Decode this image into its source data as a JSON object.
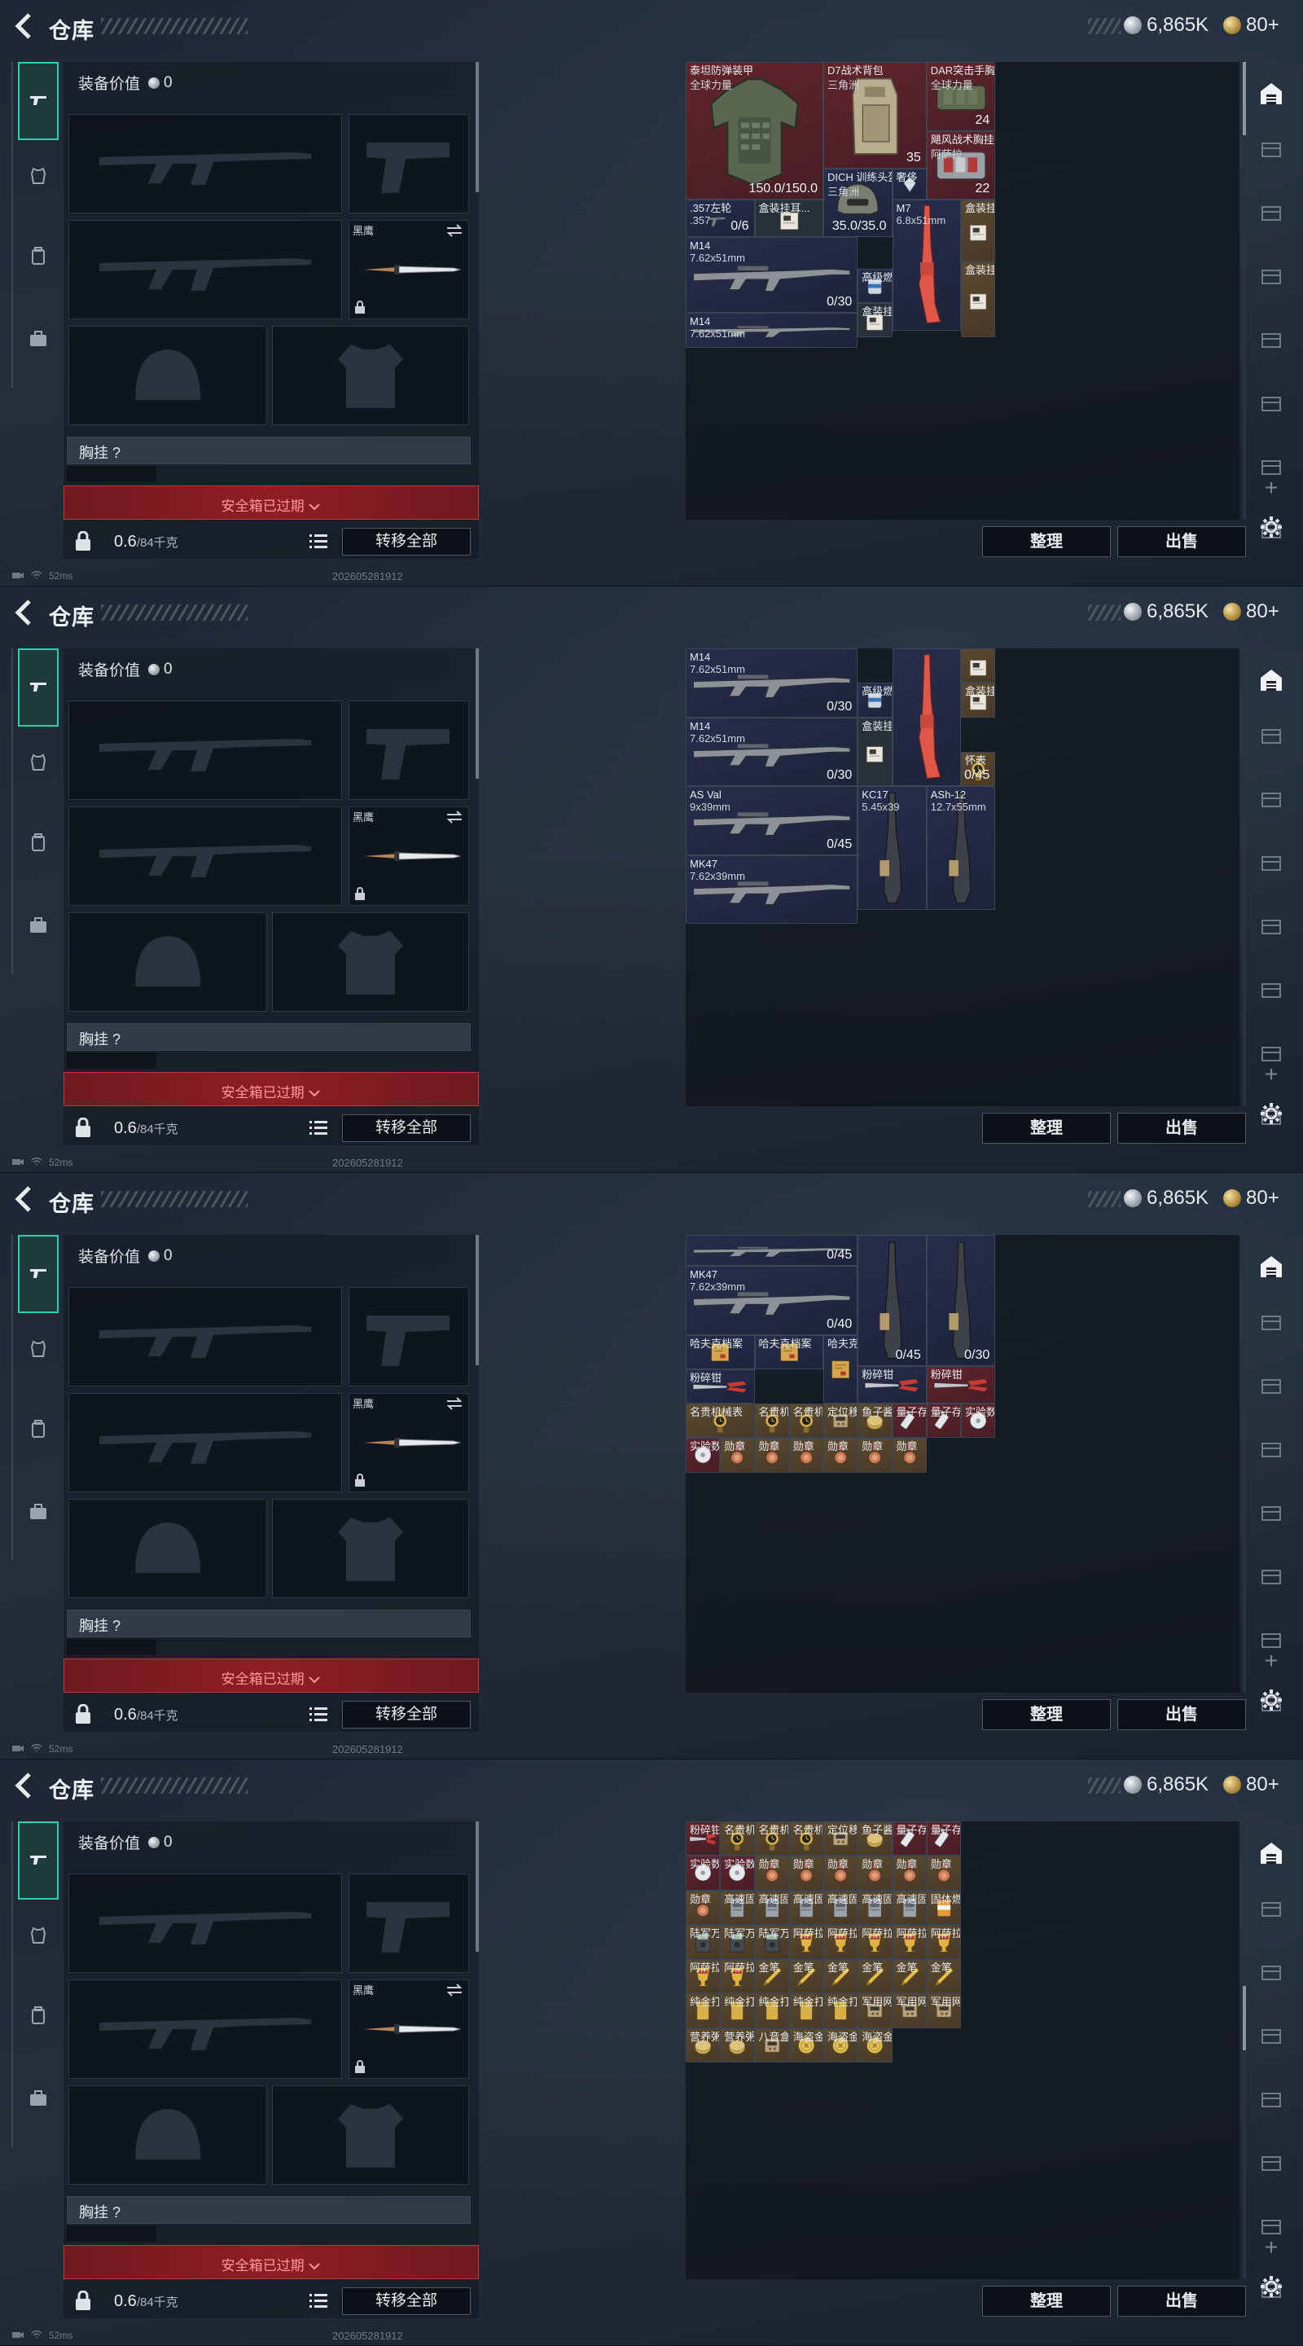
{
  "header": {
    "title": "仓库"
  },
  "currency": {
    "silver": "6,865K",
    "gold": "80+"
  },
  "equip": {
    "value_label": "装备价值",
    "value": "0",
    "knife_label": "黑鹰",
    "chest_label": "胸挂 ?",
    "expired_label": "安全箱已过期",
    "weight": "0.6",
    "weight_max": "/84千克",
    "transfer_all": "转移全部"
  },
  "stash": {
    "sort": "整理",
    "sell": "出售"
  },
  "status": {
    "ping": "52ms",
    "build": "202605281912"
  },
  "screens": [
    {
      "scroll": {
        "thumb_from": 0.0,
        "thumb_to": 0.16
      },
      "items": [
        {
          "c": "red",
          "name": "泰坦防弹装甲",
          "sub": "全球力量",
          "val": "150.0/150.0",
          "art": "armor"
        },
        {
          "c": "red",
          "name": "D7战术背包",
          "sub": "三角洲",
          "cnt": "35",
          "art": "backpack"
        },
        {
          "c": "red",
          "name": "DAR突击手胸挂",
          "sub": "全球力量",
          "cnt": "24",
          "art": "rig"
        },
        {
          "c": "red",
          "name": "飓风战术胸挂",
          "sub": "阿萨拉",
          "cnt": "22",
          "art": "rig2"
        },
        {
          "c": "blue",
          "name": "DICH 训练头盔",
          "sub": "三角洲",
          "val": "35.0/35.0",
          "art": "helmet"
        },
        {
          "c": "blue",
          "name": "奢侈",
          "sub": "",
          "art": "gem"
        },
        {
          "c": "blue",
          "name": ".357左轮",
          "sub": ".357",
          "cnt": "0/6",
          "art": "revolver"
        },
        {
          "c": "gray",
          "name": "盒装挂耳...",
          "sub": "",
          "art": "box"
        },
        {
          "c": "blue",
          "name": "M7",
          "sub": "6.8x51mm",
          "art": "rifle_red"
        },
        {
          "c": "gold",
          "name": "盒装挂耳...",
          "sub": "",
          "art": "box"
        },
        {
          "c": "blue",
          "name": "M14",
          "sub": "7.62x51mm",
          "cnt": "0/30",
          "art": "rifle"
        },
        {
          "c": "blue",
          "name": "高级燃料",
          "sub": "",
          "art": "can"
        },
        {
          "c": "gray",
          "name": "盒装挂耳...",
          "sub": "",
          "art": "box"
        },
        {
          "c": "blue",
          "name": "M14",
          "sub": "7.62x51mm",
          "art": "rifle"
        },
        {
          "c": "gold",
          "name": "盒装挂耳...",
          "sub": "",
          "art": "box"
        }
      ]
    },
    {
      "scroll": {
        "thumb_from": 0.0,
        "thumb_to": 0.0
      },
      "items": [
        {
          "c": "blue",
          "name": "M14",
          "sub": "7.62x51mm",
          "cnt": "0/30",
          "art": "rifle"
        },
        {
          "c": "blue",
          "name": "高级燃料",
          "sub": "",
          "art": "can"
        },
        {
          "c": "blue",
          "name": "",
          "sub": "",
          "art": "rifle_red"
        },
        {
          "c": "gold",
          "name": "",
          "sub": "",
          "art": "box"
        },
        {
          "c": "gold",
          "name": "盒装挂耳...",
          "sub": "",
          "art": "box"
        },
        {
          "c": "gray",
          "name": "盒装挂耳...",
          "sub": "",
          "art": "box"
        },
        {
          "c": "blue",
          "name": "M14",
          "sub": "7.62x51mm",
          "cnt": "0/30",
          "art": "rifle"
        },
        {
          "c": "gold",
          "name": "怀表",
          "sub": "",
          "cnt": "0/45",
          "art": "watch"
        },
        {
          "c": "blue",
          "name": "AS Val",
          "sub": "9x39mm",
          "cnt": "0/45",
          "art": "rifle"
        },
        {
          "c": "blue",
          "name": "KC17",
          "sub": "5.45x39",
          "art": "rifle_v"
        },
        {
          "c": "blue",
          "name": "ASh-12",
          "sub": "12.7x55mm",
          "art": "rifle_v"
        },
        {
          "c": "blue",
          "name": "MK47",
          "sub": "7.62x39mm",
          "art": "rifle"
        }
      ]
    },
    {
      "scroll": {
        "thumb_from": 0.0,
        "thumb_to": 0.0
      },
      "items": [
        {
          "c": "blue",
          "name": "",
          "sub": "",
          "cnt": "0/45",
          "art": "rifle"
        },
        {
          "c": "blue",
          "name": "MK47",
          "sub": "7.62x39mm",
          "cnt": "0/40",
          "art": "rifle"
        },
        {
          "c": "blue",
          "name": "",
          "sub": "",
          "cnt": "0/45",
          "art": "rifle_v"
        },
        {
          "c": "blue",
          "name": "",
          "sub": "",
          "cnt": "0/30",
          "art": "rifle_v"
        },
        {
          "c": "blue",
          "name": "哈夫克档案",
          "sub": "",
          "art": "doc"
        },
        {
          "c": "blue",
          "name": "哈夫克档案",
          "sub": "",
          "art": "doc"
        },
        {
          "c": "blue",
          "name": "哈夫克档案",
          "sub": "",
          "art": "doc"
        },
        {
          "c": "blue",
          "name": "粉碎钳",
          "sub": "",
          "art": "cutter"
        },
        {
          "c": "blue",
          "name": "粉碎钳",
          "sub": "",
          "art": "cutter"
        },
        {
          "c": "red",
          "name": "粉碎钳",
          "sub": "",
          "art": "cutter"
        },
        {
          "c": "gold",
          "name": "名贵机械表",
          "sub": "",
          "art": "watch"
        },
        {
          "c": "gold",
          "name": "名贵机械表",
          "sub": "",
          "art": "watch"
        },
        {
          "c": "gold",
          "name": "名贵机械表",
          "sub": "",
          "art": "watch"
        },
        {
          "c": "gold",
          "name": "定位移动器",
          "sub": "",
          "art": "device"
        },
        {
          "c": "gold",
          "name": "鱼子酱",
          "sub": "",
          "art": "tin"
        },
        {
          "c": "red",
          "name": "量子存储",
          "sub": "",
          "art": "usb"
        },
        {
          "c": "red",
          "name": "量子存储",
          "sub": "",
          "art": "usb"
        },
        {
          "c": "red",
          "name": "实验数据",
          "sub": "",
          "art": "disc"
        },
        {
          "c": "red",
          "name": "实验数据",
          "sub": "",
          "art": "disc"
        },
        {
          "c": "gold",
          "name": "勋章",
          "sub": "",
          "art": "medal"
        },
        {
          "c": "gold",
          "name": "勋章",
          "sub": "",
          "art": "medal"
        },
        {
          "c": "gold",
          "name": "勋章",
          "sub": "",
          "art": "medal"
        },
        {
          "c": "gold",
          "name": "勋章",
          "sub": "",
          "art": "medal"
        },
        {
          "c": "gold",
          "name": "勋章",
          "sub": "",
          "art": "medal"
        },
        {
          "c": "gold",
          "name": "勋章",
          "sub": "",
          "art": "medal"
        }
      ]
    },
    {
      "scroll": {
        "thumb_from": 0.36,
        "thumb_to": 0.5
      },
      "items": [
        {
          "c": "red",
          "name": "粉碎钳",
          "sub": "",
          "art": "cutter"
        },
        {
          "c": "gold",
          "name": "名贵机械表",
          "sub": "",
          "art": "watch"
        },
        {
          "c": "gold",
          "name": "名贵机械表",
          "sub": "",
          "art": "watch"
        },
        {
          "c": "gold",
          "name": "名贵机械表",
          "sub": "",
          "art": "watch"
        },
        {
          "c": "gold",
          "name": "定位移动器",
          "sub": "",
          "art": "device"
        },
        {
          "c": "gold",
          "name": "鱼子酱",
          "sub": "",
          "art": "tin"
        },
        {
          "c": "red",
          "name": "量子存储",
          "sub": "",
          "art": "usb"
        },
        {
          "c": "red",
          "name": "量子存储",
          "sub": "",
          "art": "usb"
        },
        {
          "c": "red",
          "name": "实验数据",
          "sub": "",
          "art": "disc"
        },
        {
          "c": "red",
          "name": "实验数据",
          "sub": "",
          "art": "disc"
        },
        {
          "c": "gold",
          "name": "勋章",
          "sub": "",
          "art": "medal"
        },
        {
          "c": "gold",
          "name": "勋章",
          "sub": "",
          "art": "medal"
        },
        {
          "c": "gold",
          "name": "勋章",
          "sub": "",
          "art": "medal"
        },
        {
          "c": "gold",
          "name": "勋章",
          "sub": "",
          "art": "medal"
        },
        {
          "c": "gold",
          "name": "勋章",
          "sub": "",
          "art": "medal"
        },
        {
          "c": "gold",
          "name": "勋章",
          "sub": "",
          "art": "medal"
        },
        {
          "c": "gold",
          "name": "勋章",
          "sub": "",
          "art": "medal"
        },
        {
          "c": "gold",
          "name": "高速固态...",
          "sub": "",
          "art": "ssd"
        },
        {
          "c": "gold",
          "name": "高速固态...",
          "sub": "",
          "art": "ssd"
        },
        {
          "c": "gold",
          "name": "高速固态...",
          "sub": "",
          "art": "ssd"
        },
        {
          "c": "gold",
          "name": "高速固态...",
          "sub": "",
          "art": "ssd"
        },
        {
          "c": "gold",
          "name": "高速固态...",
          "sub": "",
          "art": "ssd"
        },
        {
          "c": "gold",
          "name": "高速固态...",
          "sub": "",
          "art": "ssd"
        },
        {
          "c": "gold",
          "name": "固体燃料",
          "sub": "",
          "art": "fuel"
        },
        {
          "c": "gold",
          "name": "陆军万用表",
          "sub": "",
          "art": "meter"
        },
        {
          "c": "gold",
          "name": "陆军万用表",
          "sub": "",
          "art": "meter"
        },
        {
          "c": "gold",
          "name": "陆军万用表",
          "sub": "",
          "art": "meter"
        },
        {
          "c": "gold",
          "name": "阿萨拉酒杯",
          "sub": "",
          "art": "cup"
        },
        {
          "c": "gold",
          "name": "阿萨拉酒杯",
          "sub": "",
          "art": "cup"
        },
        {
          "c": "gold",
          "name": "阿萨拉酒杯",
          "sub": "",
          "art": "cup"
        },
        {
          "c": "gold",
          "name": "阿萨拉酒杯",
          "sub": "",
          "art": "cup"
        },
        {
          "c": "gold",
          "name": "阿萨拉酒杯",
          "sub": "",
          "art": "cup"
        },
        {
          "c": "gold",
          "name": "阿萨拉酒杯",
          "sub": "",
          "art": "cup"
        },
        {
          "c": "gold",
          "name": "阿萨拉酒杯",
          "sub": "",
          "art": "cup"
        },
        {
          "c": "gold",
          "name": "金笔",
          "sub": "",
          "art": "pen"
        },
        {
          "c": "gold",
          "name": "金笔",
          "sub": "",
          "art": "pen"
        },
        {
          "c": "gold",
          "name": "金笔",
          "sub": "",
          "art": "pen"
        },
        {
          "c": "gold",
          "name": "金笔",
          "sub": "",
          "art": "pen"
        },
        {
          "c": "gold",
          "name": "金笔",
          "sub": "",
          "art": "pen"
        },
        {
          "c": "gold",
          "name": "金笔",
          "sub": "",
          "art": "pen"
        },
        {
          "c": "gold",
          "name": "纯金打火机",
          "sub": "",
          "art": "lighter"
        },
        {
          "c": "gold",
          "name": "纯金打火机",
          "sub": "",
          "art": "lighter"
        },
        {
          "c": "gold",
          "name": "纯金打火机",
          "sub": "",
          "art": "lighter"
        },
        {
          "c": "gold",
          "name": "纯金打火机",
          "sub": "",
          "art": "lighter"
        },
        {
          "c": "gold",
          "name": "纯金打火机",
          "sub": "",
          "art": "lighter"
        },
        {
          "c": "gold",
          "name": "军用网络...",
          "sub": "",
          "art": "device"
        },
        {
          "c": "gold",
          "name": "军用网络...",
          "sub": "",
          "art": "device"
        },
        {
          "c": "gold",
          "name": "军用网络...",
          "sub": "",
          "art": "device"
        },
        {
          "c": "gold",
          "name": "营养粥罐头",
          "sub": "",
          "art": "tin"
        },
        {
          "c": "gold",
          "name": "营养粥罐头",
          "sub": "",
          "art": "tin"
        },
        {
          "c": "gold",
          "name": "八音盒",
          "sub": "",
          "art": "device"
        },
        {
          "c": "gold",
          "name": "海盗金币",
          "sub": "",
          "art": "coin"
        },
        {
          "c": "gold",
          "name": "海盗金币",
          "sub": "",
          "art": "coin"
        },
        {
          "c": "gold",
          "name": "海盗金币",
          "sub": "",
          "art": "coin"
        }
      ]
    }
  ]
}
